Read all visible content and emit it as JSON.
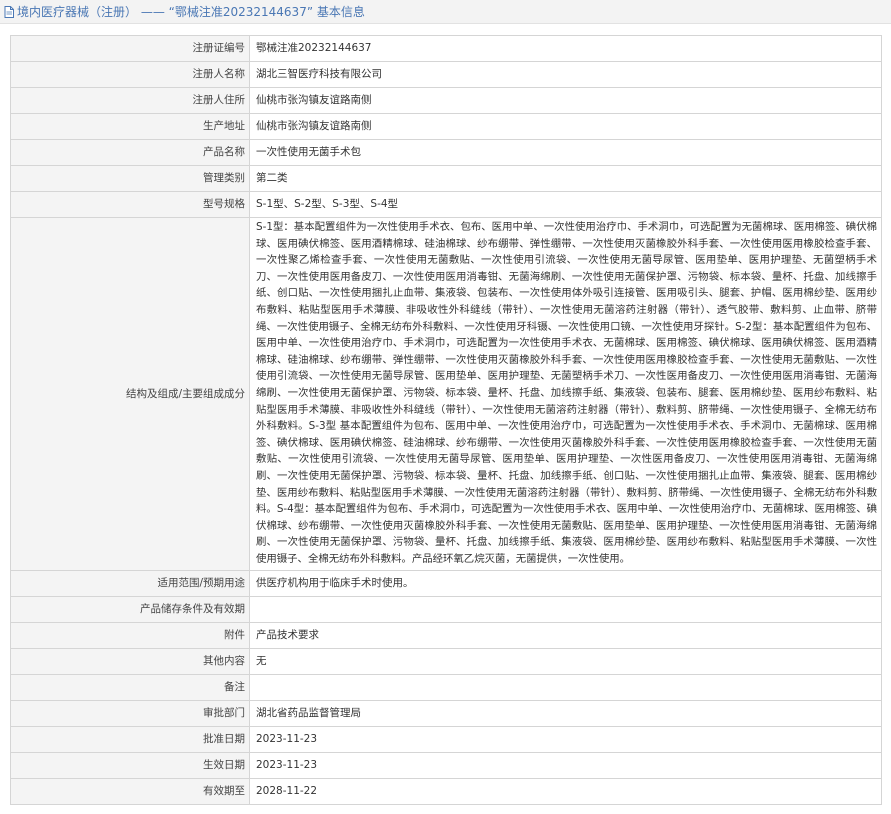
{
  "header": {
    "title": "境内医疗器械（注册） —— “鄂械注准20232144637” 基本信息",
    "icon": "document-icon"
  },
  "rows": [
    {
      "label": "注册证编号",
      "value": "鄂械注准20232144637"
    },
    {
      "label": "注册人名称",
      "value": "湖北三智医疗科技有限公司"
    },
    {
      "label": "注册人住所",
      "value": "仙桃市张沟镇友谊路南侧"
    },
    {
      "label": "生产地址",
      "value": "仙桃市张沟镇友谊路南侧"
    },
    {
      "label": "产品名称",
      "value": "一次性使用无菌手术包"
    },
    {
      "label": "管理类别",
      "value": "第二类"
    },
    {
      "label": "型号规格",
      "value": "S-1型、S-2型、S-3型、S-4型"
    },
    {
      "label": "结构及组成/主要组成成分",
      "value": "S-1型：基本配置组件为一次性使用手术衣、包布、医用中单、一次性使用治疗巾、手术洞巾，可选配置为无菌棉球、医用棉签、碘伏棉球、医用碘伏棉签、医用酒精棉球、硅油棉球、纱布绷带、弹性绷带、一次性使用灭菌橡胶外科手套、一次性使用医用橡胶检查手套、一次性聚乙烯检查手套、一次性使用无菌敷贴、一次性使用引流袋、一次性使用无菌导尿管、医用垫单、医用护理垫、无菌塑柄手术刀、一次性使用医用备皮刀、一次性使用医用消毒钳、无菌海绵刷、一次性使用无菌保护罩、污物袋、标本袋、量杯、托盘、加线擦手纸、创口贴、一次性使用捆扎止血带、集液袋、包装布、一次性使用体外吸引连接管、医用吸引头、腿套、护帽、医用棉纱垫、医用纱布敷料、粘贴型医用手术薄膜、非吸收性外科缝线（带针）、一次性使用无菌溶药注射器（带针）、透气胶带、敷料剪、止血带、脐带绳、一次性使用镊子、全棉无纺布外科敷料、一次性使用牙科镊、一次性使用口镜、一次性使用牙探针。S-2型：基本配置组件为包布、医用中单、一次性使用治疗巾、手术洞巾，可选配置为一次性使用手术衣、无菌棉球、医用棉签、碘伏棉球、医用碘伏棉签、医用酒精棉球、硅油棉球、纱布绷带、弹性绷带、一次性使用灭菌橡胶外科手套、一次性使用医用橡胶检查手套、一次性使用无菌敷贴、一次性使用引流袋、一次性使用无菌导尿管、医用垫单、医用护理垫、无菌塑柄手术刀、一次性医用备皮刀、一次性使用医用消毒钳、无菌海绵刷、一次性使用无菌保护罩、污物袋、标本袋、量杯、托盘、加线擦手纸、集液袋、包装布、腿套、医用棉纱垫、医用纱布敷料、粘贴型医用手术薄膜、非吸收性外科缝线（带针）、一次性使用无菌溶药注射器（带针）、敷料剪、脐带绳、一次性使用镊子、全棉无纺布外科敷料。S-3型 基本配置组件为包布、医用中单、一次性使用治疗巾，可选配置为一次性使用手术衣、手术洞巾、无菌棉球、医用棉签、碘伏棉球、医用碘伏棉签、硅油棉球、纱布绷带、一次性使用灭菌橡胶外科手套、一次性使用医用橡胶检查手套、一次性使用无菌敷贴、一次性使用引流袋、一次性使用无菌导尿管、医用垫单、医用护理垫、一次性医用备皮刀、一次性使用医用消毒钳、无菌海绵刷、一次性使用无菌保护罩、污物袋、标本袋、量杯、托盘、加线擦手纸、创口贴、一次性使用捆扎止血带、集液袋、腿套、医用棉纱垫、医用纱布敷料、粘贴型医用手术薄膜、一次性使用无菌溶药注射器（带针）、敷料剪、脐带绳、一次性使用镊子、全棉无纺布外科敷料。S-4型：基本配置组件为包布、手术洞巾，可选配置为一次性使用手术衣、医用中单、一次性使用治疗巾、无菌棉球、医用棉签、碘伏棉球、纱布绷带、一次性使用灭菌橡胶外科手套、一次性使用无菌敷贴、医用垫单、医用护理垫、一次性使用医用消毒钳、无菌海绵刷、一次性使用无菌保护罩、污物袋、量杯、托盘、加线擦手纸、集液袋、医用棉纱垫、医用纱布敷料、粘贴型医用手术薄膜、一次性使用镊子、全棉无纺布外科敷料。产品经环氧乙烷灭菌，无菌提供，一次性使用。"
    },
    {
      "label": "适用范围/预期用途",
      "value": "供医疗机构用于临床手术时使用。"
    },
    {
      "label": "产品储存条件及有效期",
      "value": ""
    },
    {
      "label": "附件",
      "value": "产品技术要求"
    },
    {
      "label": "其他内容",
      "value": "无"
    },
    {
      "label": "备注",
      "value": ""
    },
    {
      "label": "审批部门",
      "value": "湖北省药品监督管理局"
    },
    {
      "label": "批准日期",
      "value": "2023-11-23"
    },
    {
      "label": "生效日期",
      "value": "2023-11-23"
    },
    {
      "label": "有效期至",
      "value": "2028-11-22"
    }
  ]
}
